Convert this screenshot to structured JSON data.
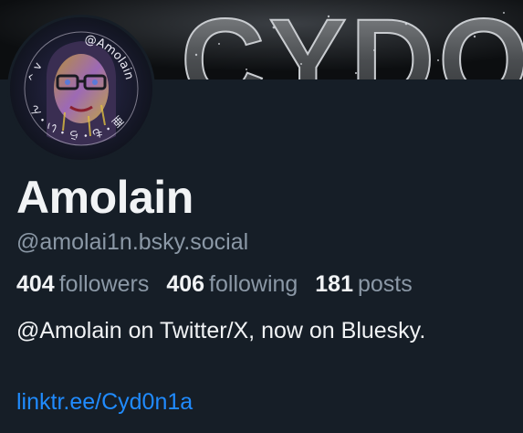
{
  "banner": {
    "text": "CYDO",
    "background": "#0c0e10"
  },
  "avatar": {
    "ring_text": "@Amolain",
    "ring_text_jp": "亜・も・ら・い・ん",
    "ring_text_prefix": "^ v"
  },
  "profile": {
    "display_name": "Amolain",
    "handle": "@amolai1n.bsky.social",
    "bio": "@Amolain on Twitter/X, now on Bluesky.",
    "link": "linktr.ee/Cyd0n1a"
  },
  "stats": {
    "followers_count": "404",
    "followers_label": "followers",
    "following_count": "406",
    "following_label": "following",
    "posts_count": "181",
    "posts_label": "posts"
  },
  "colors": {
    "background": "#161e27",
    "text_primary": "#f1f3f5",
    "text_secondary": "#8b98a6",
    "link": "#208bfe"
  }
}
